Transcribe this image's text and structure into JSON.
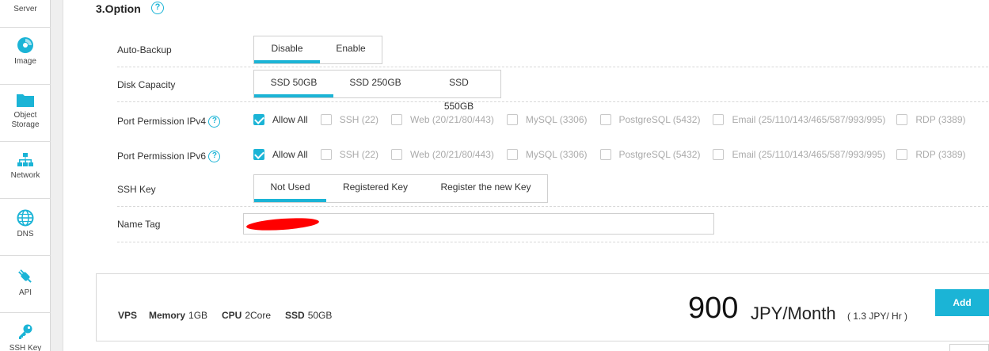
{
  "sidebar": {
    "items": [
      {
        "label": "Server",
        "icon": "server-icon"
      },
      {
        "label": "Image",
        "icon": "disc-icon"
      },
      {
        "label": "Object Storage",
        "label_lines": [
          "Object",
          "Storage"
        ],
        "icon": "folder-icon"
      },
      {
        "label": "Network",
        "icon": "network-icon"
      },
      {
        "label": "DNS",
        "icon": "globe-icon"
      },
      {
        "label": "API",
        "icon": "plug-icon"
      },
      {
        "label": "SSH Key",
        "icon": "key-icon"
      }
    ]
  },
  "section": {
    "title": "3.Option",
    "help": "?"
  },
  "auto_backup": {
    "label": "Auto-Backup",
    "options": [
      "Disable",
      "Enable"
    ],
    "selected": "Disable"
  },
  "disk_capacity": {
    "label": "Disk Capacity",
    "options": [
      "SSD 50GB",
      "SSD 250GB",
      "SSD 550GB"
    ],
    "selected": "SSD 50GB"
  },
  "port_ipv4": {
    "label": "Port Permission IPv4",
    "help": "?",
    "options": [
      {
        "label": "Allow All",
        "checked": true
      },
      {
        "label": "SSH (22)",
        "checked": false
      },
      {
        "label": "Web (20/21/80/443)",
        "checked": false
      },
      {
        "label": "MySQL (3306)",
        "checked": false
      },
      {
        "label": "PostgreSQL (5432)",
        "checked": false
      },
      {
        "label": "Email (25/110/143/465/587/993/995)",
        "checked": false
      },
      {
        "label": "RDP (3389)",
        "checked": false
      }
    ]
  },
  "port_ipv6": {
    "label": "Port Permission IPv6",
    "help": "?",
    "options": [
      {
        "label": "Allow All",
        "checked": true
      },
      {
        "label": "SSH (22)",
        "checked": false
      },
      {
        "label": "Web (20/21/80/443)",
        "checked": false
      },
      {
        "label": "MySQL (3306)",
        "checked": false
      },
      {
        "label": "PostgreSQL (5432)",
        "checked": false
      },
      {
        "label": "Email (25/110/143/465/587/993/995)",
        "checked": false
      },
      {
        "label": "RDP (3389)",
        "checked": false
      }
    ]
  },
  "ssh_key": {
    "label": "SSH Key",
    "options": [
      "Not Used",
      "Registered Key",
      "Register the new Key"
    ],
    "selected": "Not Used"
  },
  "name_tag": {
    "label": "Name Tag",
    "value": ""
  },
  "summary": {
    "vps": "VPS",
    "memory_label": "Memory",
    "memory_value": "1GB",
    "cpu_label": "CPU",
    "cpu_value": "2Core",
    "ssd_label": "SSD",
    "ssd_value": "50GB",
    "price": "900",
    "price_unit": "JPY/Month",
    "price_hourly": "( 1.3 JPY/ Hr )"
  },
  "add_button": {
    "label": "Add"
  },
  "colors": {
    "accent": "#1bb4d6",
    "redaction": "#ff0000"
  }
}
